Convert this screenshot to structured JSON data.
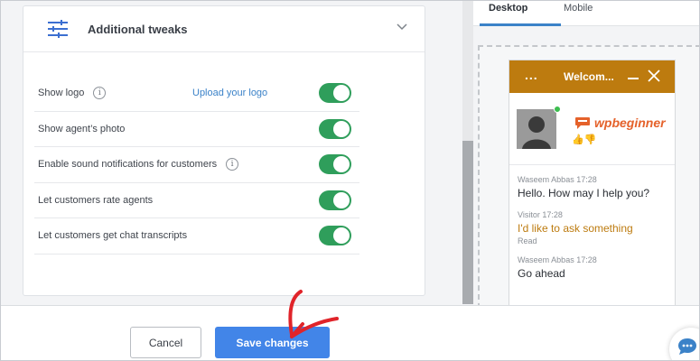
{
  "panel": {
    "title": "Additional tweaks",
    "icons": {
      "header": "sliders-icon",
      "collapse": "chevron-down-icon"
    },
    "rows": [
      {
        "label": "Show logo",
        "info": "i",
        "action": "Upload your logo",
        "enabled": true
      },
      {
        "label": "Show agent’s photo",
        "enabled": true
      },
      {
        "label": "Enable sound notifications for customers",
        "info": "i",
        "enabled": true
      },
      {
        "label": "Let customers rate agents",
        "enabled": true
      },
      {
        "label": "Let customers get chat transcripts",
        "enabled": true
      }
    ]
  },
  "preview": {
    "tabs": [
      {
        "label": "Desktop",
        "active": true
      },
      {
        "label": "Mobile",
        "active": false
      }
    ],
    "chat": {
      "menu": "...",
      "title": "Welcom...",
      "brand": "wpbeginner",
      "messages": [
        {
          "author": "Waseem Abbas",
          "time": "17:28",
          "text": "Hello. How may I help you?"
        },
        {
          "author": "Visitor",
          "time": "17:28",
          "text": "I'd like to ask something",
          "status": "Read"
        },
        {
          "author": "Waseem Abbas",
          "time": "17:28",
          "text": "Go ahead"
        }
      ]
    }
  },
  "footer": {
    "cancel_label": "Cancel",
    "save_label": "Save changes"
  },
  "colors": {
    "toggle_on": "#2f9e5b",
    "chat_header": "#bd7b0f",
    "primary_button": "#4285e8",
    "link": "#3b82c8",
    "annotation_arrow": "#e0242a"
  }
}
